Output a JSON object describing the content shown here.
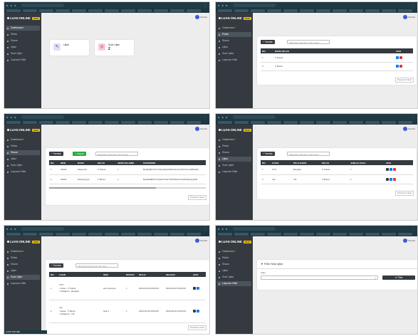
{
  "app": {
    "brand": "LUAN ONLINE",
    "brand_tag": "RKW",
    "user": "Nautika",
    "nav": [
      "Dashboard",
      "Relas",
      "Siswa",
      "Ujian",
      "Soal Ujian",
      "Laporan Nilai"
    ]
  },
  "dashboard": {
    "cards": [
      {
        "label": "Ujian",
        "value": "",
        "icon": "edit-icon"
      },
      {
        "label": "Soal Ujian",
        "value": "2",
        "icon": "target-icon"
      }
    ]
  },
  "kelas": {
    "add_label": "Tambah",
    "search_placeholder": "Masukkan kata kunci dari Kelas",
    "columns": [
      "NO.",
      "NAMA KELAS",
      "AKSI"
    ],
    "rows": [
      [
        "1",
        "X Teknik"
      ],
      [
        "2",
        "X Bisnis"
      ]
    ],
    "pager": "Previous 1 Next"
  },
  "siswa": {
    "add_label": "Tambah",
    "import_label": "Import",
    "search_placeholder": "Masukkan kata kunci dari Siswa",
    "columns": [
      "NO.",
      "NISN",
      "NAMA",
      "KELAS",
      "JENIS KELAMIN",
      "PASSWORD"
    ],
    "rows": [
      [
        "1",
        "33333",
        "Siswa Ais",
        "X Teknik",
        "L",
        "$2y$10$x7VmsVNsUa5y2hRNeI4U7uoTbCVUemdRMdsX"
      ],
      [
        "2",
        "23333",
        "Workingniya",
        "X Bisnis",
        "L",
        "$2y$10$8hXYvUj9aJ7n6HYhZtVbD0nC1vWk2QeGpQ4R"
      ]
    ],
    "pager": "Previous 1 Next"
  },
  "ujian": {
    "add_label": "Tambah",
    "search_placeholder": "Masukkan kata kunci dari Ujian",
    "columns": [
      "NO.",
      "UJIAN",
      "PELAJARAN",
      "KELAS",
      "JUMLAH SOAL",
      "AKSI"
    ],
    "rows": [
      [
        "1",
        "UTS",
        "Bengkel",
        "X Teknik",
        "1"
      ],
      [
        "2",
        "uas",
        "TIK",
        "X Bisnis",
        "1"
      ]
    ],
    "pager": "Previous 1 Next"
  },
  "soal": {
    "add_label": "Tambah",
    "search_placeholder": "Masukkan kata kunci dari Soal",
    "columns": [
      "NO.",
      "UJIAN",
      "SESI",
      "DURASI",
      "MULAI",
      "SELESAI",
      "AKSI"
    ],
    "rows": [
      {
        "no": "1",
        "ujian": "UTS",
        "kelas": "Kelas : X Teknik",
        "pelajaran": "Pelajaran : Bengkel",
        "sesi": "sesi pertama",
        "durasi": "1",
        "mulai": "2023-09-26 08:00:00",
        "selesai": "2023-09-26 09:00:00"
      },
      {
        "no": "2",
        "ujian": "uas",
        "kelas": "Kelas : X Bisnis",
        "pelajaran": "Pelajaran : TIK",
        "sesi": "Sesi 1",
        "durasi": "1",
        "mulai": "2023-09-26 08:00:00",
        "selesai": "2023-09-26 09:00:00"
      }
    ],
    "pager": "Previous 1 Next"
  },
  "laporan": {
    "title": "Filter Nilai Ujian",
    "field_label": "Ujian",
    "filter_label": "Filter"
  },
  "taskbar_label": "LUAN ONLINE"
}
